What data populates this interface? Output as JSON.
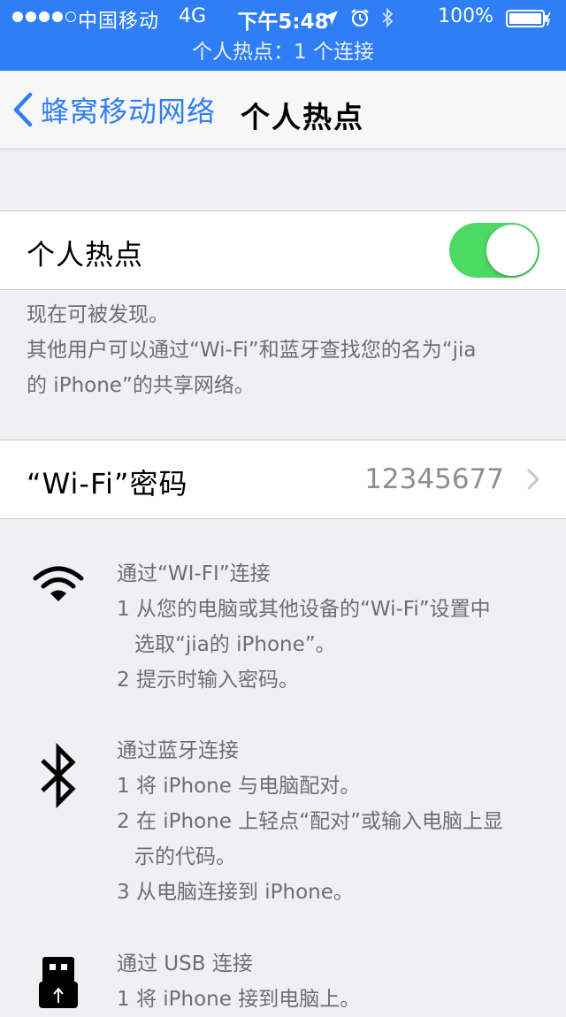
{
  "status_bar": {
    "carrier": "中国移动",
    "network": "4G",
    "time": "下午5:48",
    "battery_pct": "100%",
    "icons": [
      "location-arrow-icon",
      "alarm-clock-icon",
      "bluetooth-icon",
      "battery-icon"
    ],
    "hotspot_banner": "个人热点：1 个连接"
  },
  "nav": {
    "back_label": "蜂窝移动网络",
    "title": "个人热点"
  },
  "hotspot": {
    "label": "个人热点",
    "enabled": true
  },
  "discover": {
    "line1": "现在可被发现。",
    "line2": "其他用户可以通过“Wi-Fi”和蓝牙查找您的名为“jia",
    "line3": "的 iPhone”的共享网络。"
  },
  "wifi_password": {
    "label": "“Wi-Fi”密码",
    "value": "12345677"
  },
  "instructions": {
    "wifi": {
      "icon": "wifi-icon",
      "title": "通过“WI-FI”连接",
      "step1a": "1 从您的电脑或其他设备的“Wi-Fi”设置中",
      "step1b": "选取“jia的 iPhone”。",
      "step2": "2 提示时输入密码。"
    },
    "bluetooth": {
      "icon": "bluetooth-icon",
      "title": "通过蓝牙连接",
      "step1": "1 将 iPhone 与电脑配对。",
      "step2a": "2 在 iPhone 上轻点“配对”或输入电脑上显",
      "step2b": "示的代码。",
      "step3": "3 从电脑连接到 iPhone。"
    },
    "usb": {
      "icon": "usb-icon",
      "title": "通过 USB 连接",
      "step1": "1 将 iPhone 接到电脑上。"
    }
  },
  "colors": {
    "accent": "#2f7ef5",
    "toggle_on": "#4cd964",
    "background": "#efeff4",
    "footer_text": "#6d6d72"
  }
}
